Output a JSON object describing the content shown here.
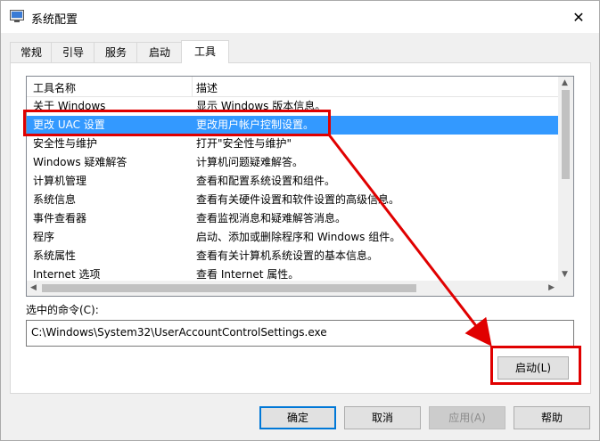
{
  "window": {
    "title": "系统配置"
  },
  "tabs": [
    {
      "label": "常规",
      "active": false
    },
    {
      "label": "引导",
      "active": false
    },
    {
      "label": "服务",
      "active": false
    },
    {
      "label": "启动",
      "active": false
    },
    {
      "label": "工具",
      "active": true
    }
  ],
  "tools_list": {
    "columns": [
      "工具名称",
      "描述"
    ],
    "rows": [
      {
        "name": "关于 Windows",
        "desc": "显示 Windows 版本信息。"
      },
      {
        "name": "更改 UAC 设置",
        "desc": "更改用户帐户控制设置。",
        "selected": true
      },
      {
        "name": "安全性与维护",
        "desc": "打开\"安全性与维护\""
      },
      {
        "name": "Windows 疑难解答",
        "desc": "计算机问题疑难解答。"
      },
      {
        "name": "计算机管理",
        "desc": "查看和配置系统设置和组件。"
      },
      {
        "name": "系统信息",
        "desc": "查看有关硬件设置和软件设置的高级信息。"
      },
      {
        "name": "事件查看器",
        "desc": "查看监视消息和疑难解答消息。"
      },
      {
        "name": "程序",
        "desc": "启动、添加或删除程序和 Windows 组件。"
      },
      {
        "name": "系统属性",
        "desc": "查看有关计算机系统设置的基本信息。"
      },
      {
        "name": "Internet 选项",
        "desc": "查看 Internet 属性。"
      }
    ]
  },
  "selected_command": {
    "label": "选中的命令(C):",
    "value": "C:\\Windows\\System32\\UserAccountControlSettings.exe"
  },
  "buttons": {
    "launch": "启动(L)",
    "ok": "确定",
    "cancel": "取消",
    "apply": "应用(A)",
    "help": "帮助"
  },
  "colors": {
    "selection": "#3399ff",
    "annotation": "#e00000"
  }
}
